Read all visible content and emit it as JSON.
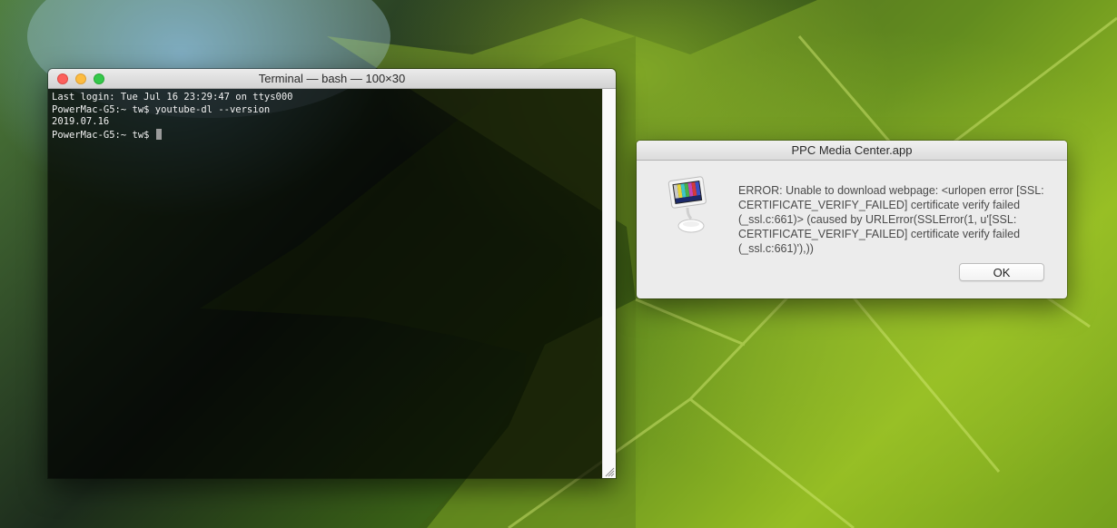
{
  "terminal": {
    "title": "Terminal — bash — 100×30",
    "lines": [
      "Last login: Tue Jul 16 23:29:47 on ttys000",
      "PowerMac-G5:~ tw$ youtube-dl --version",
      "2019.07.16",
      "PowerMac-G5:~ tw$ "
    ],
    "background": "#000000",
    "text_color": "#f2f2f2"
  },
  "alert": {
    "title": "PPC Media Center.app",
    "icon": "imac-g4-icon",
    "message": "ERROR: Unable to download webpage: <urlopen error [SSL: CERTIFICATE_VERIFY_FAILED] certificate verify failed (_ssl.c:661)> (caused by URLError(SSLError(1, u'[SSL: CERTIFICATE_VERIFY_FAILED] certificate verify failed (_ssl.c:661)'),))",
    "ok_label": "OK"
  },
  "colors": {
    "close": "#fc605c",
    "minimize": "#fdbc40",
    "zoom": "#34c84a"
  }
}
